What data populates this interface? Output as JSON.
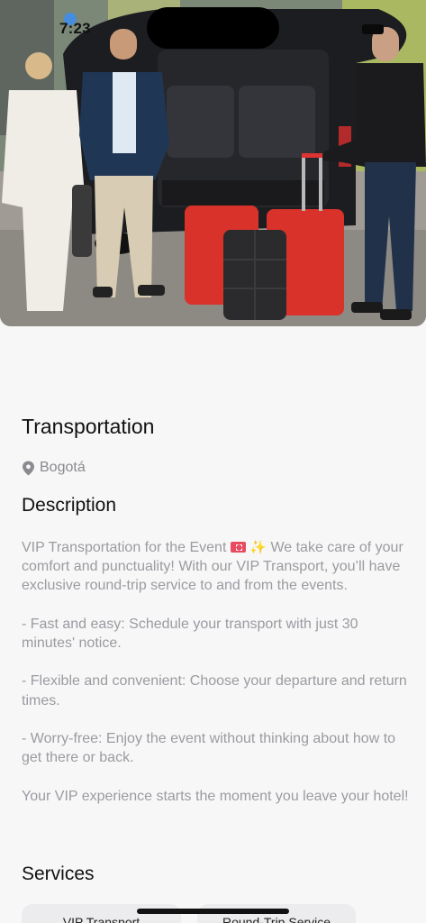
{
  "status_bar": {
    "time": "7:23"
  },
  "hero": {
    "image_description_icon": "transport-photo"
  },
  "listing": {
    "title": "Transportation",
    "location": "Bogotá"
  },
  "description": {
    "heading": "Description",
    "intro_before_emoji": "VIP Transportation for the Event",
    "intro_after_emoji": "We take care of your comfort and punctuality! With our VIP Transport, you’ll have exclusive round-trip service to and from the events.",
    "points": [
      "- Fast and easy: Schedule your transport with just 30 minutes' notice.",
      "- Flexible and convenient: Choose your departure and return times.",
      "- Worry-free: Enjoy the event without thinking about how to get there or back."
    ],
    "closing": "Your VIP experience starts the moment you leave your hotel!"
  },
  "services": {
    "heading": "Services",
    "items": [
      "VIP Transport",
      "Round-Trip Service"
    ]
  },
  "colors": {
    "background": "#f7f7f8",
    "text_primary": "#111111",
    "text_muted": "#9b9ba0",
    "chip_bg": "#ececee",
    "suitcase_red": "#d9322b"
  }
}
